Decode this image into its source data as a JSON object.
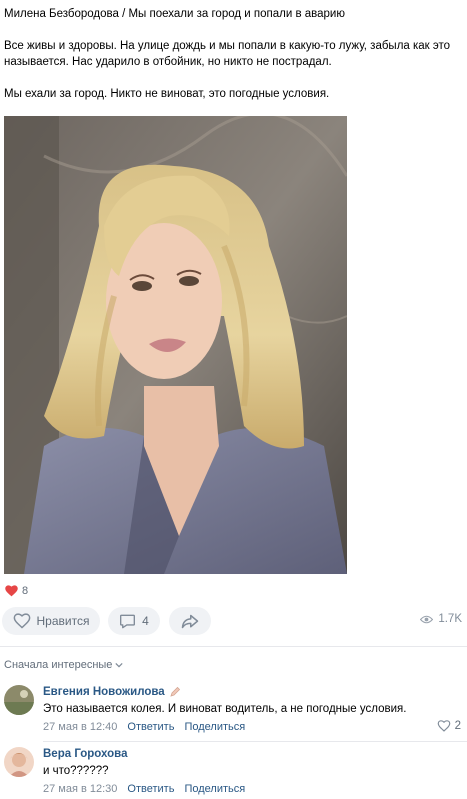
{
  "post": {
    "line1": "Милена Безбородова / Мы поехали за город и попали в аварию",
    "line2": "Все живы и здоровы. На улице дождь и мы попали в какую-то лужу, забыла как это называется. Нас ударило в отбойник, но никто не пострадал.",
    "line3": "Мы ехали за город. Никто не виноват, это погодные условия."
  },
  "reactions": {
    "count": "8"
  },
  "actions": {
    "like_label": "Нравится",
    "comment_count": "4",
    "views": "1.7K"
  },
  "comments_sort": "Сначала интересные",
  "comments": [
    {
      "author": "Евгения Новожилова",
      "text": "Это называется колея. И виноват водитель, а не погодные условия.",
      "time": "27 мая в 12:40",
      "reply": "Ответить",
      "share": "Поделиться",
      "likes": "2"
    },
    {
      "author": "Вера Горохова",
      "text": "и что??????",
      "time": "27 мая в 12:30",
      "reply": "Ответить",
      "share": "Поделиться"
    }
  ],
  "colors": {
    "link": "#2a5885",
    "muted": "#818c99",
    "pill_bg": "#f0f2f5",
    "heart": "#e64646"
  }
}
